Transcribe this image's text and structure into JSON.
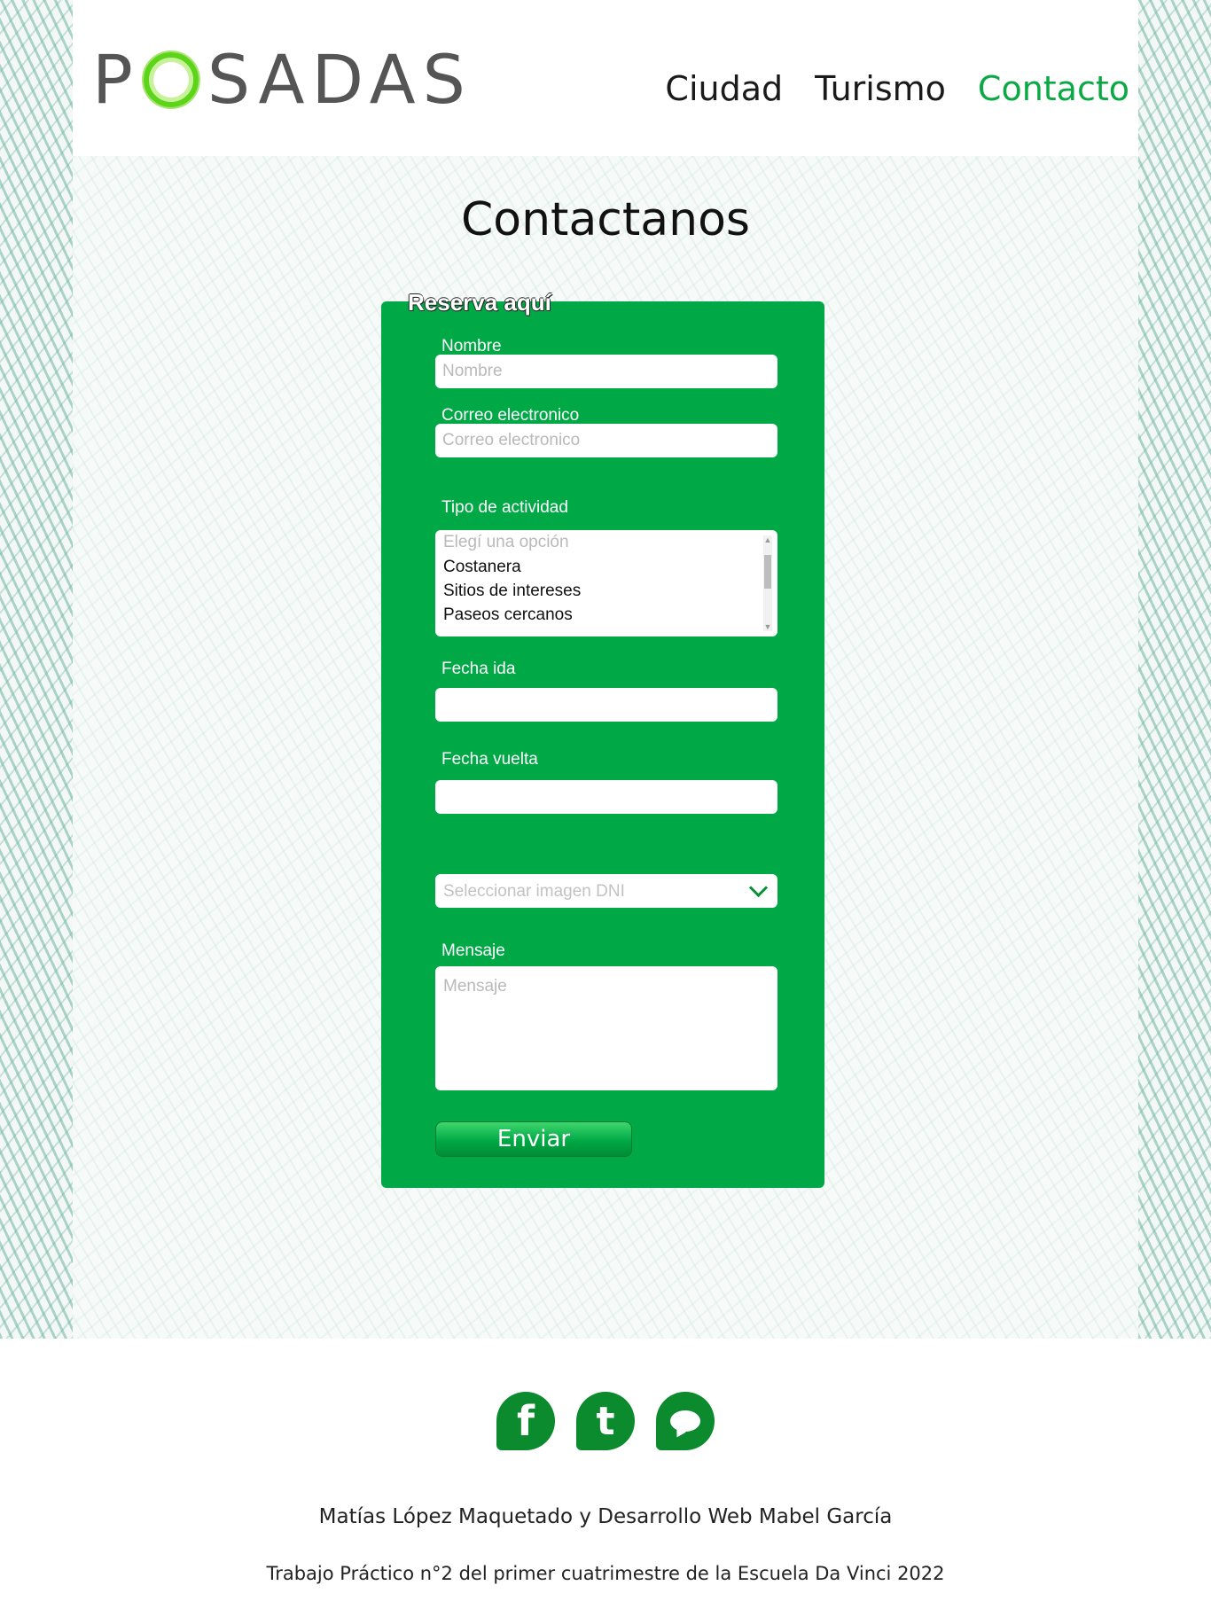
{
  "brand": {
    "logo_left": "P",
    "logo_right": "SADAS"
  },
  "nav": {
    "items": [
      {
        "label": "Ciudad"
      },
      {
        "label": "Turismo"
      },
      {
        "label": "Contacto",
        "active": true
      }
    ],
    "active_color": "#0aa944"
  },
  "main": {
    "title": "Contactanos",
    "form": {
      "legend": "Reserva aquí",
      "background_color": "#00a946",
      "name": {
        "label": "Nombre",
        "placeholder": "Nombre",
        "value": ""
      },
      "email": {
        "label": "Correo electronico",
        "placeholder": "Correo electronico",
        "value": ""
      },
      "activity": {
        "label": "Tipo de actividad",
        "placeholder": "Elegí una opción",
        "options": [
          "Costanera",
          "Sitios de intereses",
          "Paseos cercanos"
        ]
      },
      "date_out": {
        "label": "Fecha ida",
        "value": ""
      },
      "date_back": {
        "label": "Fecha vuelta",
        "value": ""
      },
      "dni_select": {
        "placeholder": "Seleccionar imagen DNI",
        "icon": "chevron-down-icon"
      },
      "message": {
        "label": "Mensaje",
        "placeholder": "Mensaje"
      },
      "submit_label": "Enviar"
    }
  },
  "footer": {
    "social": [
      {
        "icon": "facebook-icon",
        "glyph": "f"
      },
      {
        "icon": "twitter-icon",
        "glyph": "t"
      },
      {
        "icon": "chat-icon"
      }
    ],
    "credits": "Matías López Maquetado y Desarrollo Web Mabel García",
    "note": "Trabajo Práctico n°2 del primer cuatrimestre de la Escuela Da Vinci 2022"
  }
}
